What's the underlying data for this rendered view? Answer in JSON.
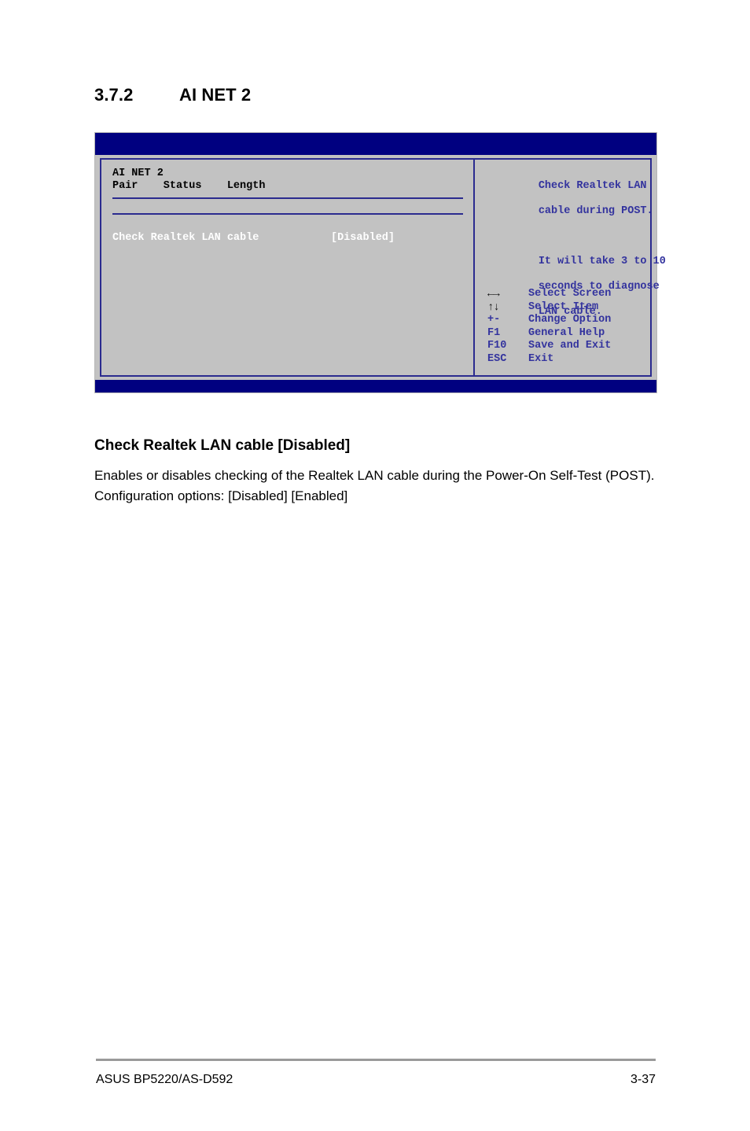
{
  "section": {
    "number": "3.7.2",
    "title": "AI NET 2"
  },
  "bios": {
    "panel_title": "AI NET 2",
    "columns": [
      "Pair",
      "Status",
      "Length"
    ],
    "columns_line": "Pair    Status    Length",
    "option": {
      "label": "Check Realtek LAN cable",
      "value": "[Disabled]"
    },
    "help": {
      "line1": "Check Realtek LAN",
      "line2": "cable during POST.",
      "line3": "It will take 3 to 10",
      "line4": "seconds to diagnose",
      "line5": "LAN cable."
    },
    "legend": [
      {
        "key": "←→",
        "desc": "Select Screen",
        "glyph": true
      },
      {
        "key": "↑↓",
        "desc": "Select Item",
        "glyph": true
      },
      {
        "key": "+-",
        "desc": "Change Option",
        "glyph": false
      },
      {
        "key": "F1",
        "desc": "General Help",
        "glyph": false
      },
      {
        "key": "F10",
        "desc": "Save and Exit",
        "glyph": false
      },
      {
        "key": "ESC",
        "desc": "Exit",
        "glyph": false
      }
    ],
    "colors": {
      "bar": "#000080",
      "panel_bg": "#c2c2c2",
      "border": "#2b2b8f",
      "help_text": "#33339e",
      "selected_text": "#ffffff"
    }
  },
  "description": {
    "heading": "Check Realtek LAN cable [Disabled]",
    "paragraph": "Enables or disables checking of the Realtek LAN cable during the Power-On Self-Test (POST).",
    "config_options": "Configuration options: [Disabled] [Enabled]"
  },
  "footer": {
    "product": "ASUS BP5220/AS-D592",
    "page": "3-37"
  }
}
